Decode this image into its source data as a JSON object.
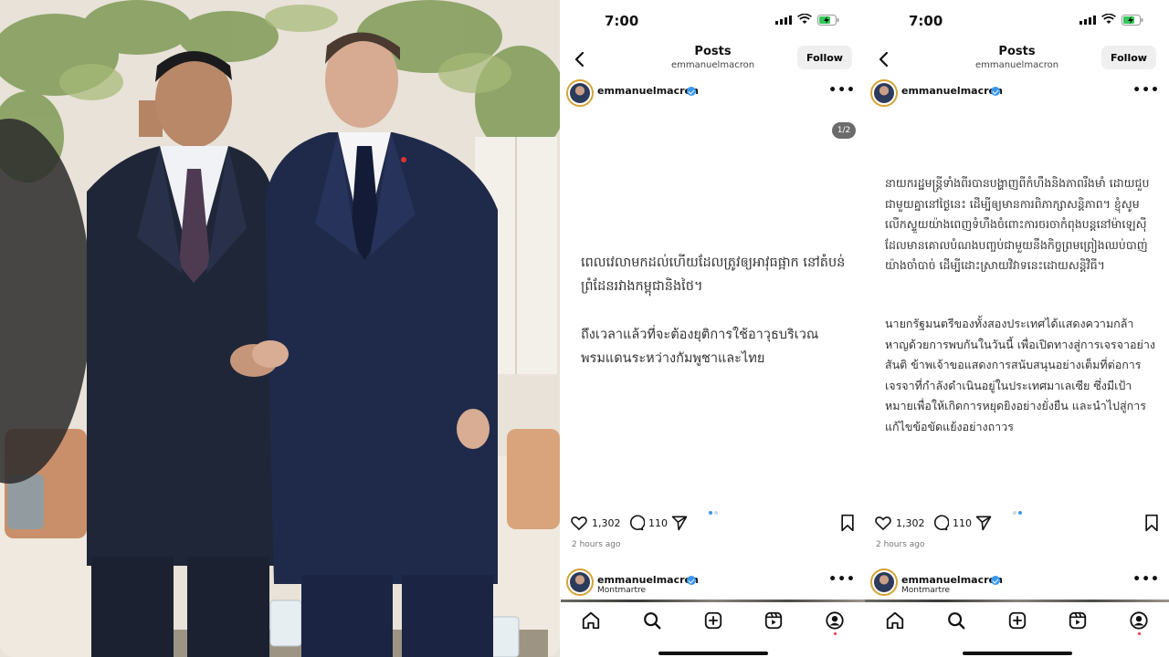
{
  "status": {
    "time": "7:00"
  },
  "nav": {
    "title": "Posts",
    "subtitle": "emmanuelmacron",
    "follow_label": "Follow"
  },
  "post": {
    "username": "emmanuelmacron",
    "counter": "1/2",
    "slide1_p1": "ពេលវេលាមកដល់ហើយដែលត្រូវឲ្យអាវុធផ្អាក នៅតំបន់ព្រំដែនរវាងកម្ពុជានិងថៃ។",
    "slide1_p2": "ถึงเวลาแล้วที่จะต้องยุติการใช้อาวุธบริเวณ พรมแดนระหว่างกัมพูชาและไทย",
    "slide2_p1": "នាយករដ្ឋមន្ត្រីទាំងពីរបានបង្ហាញពីកំហឹងនិងភាពរឹងមាំ ដោយជួបជាមួយគ្នានៅថ្ងៃនេះ ដើម្បីឲ្យមានការពិភាក្សាសន្តិភាព។ ខ្ញុំសូមលើកស្ទួយយ៉ាងពេញទំហឹងចំពោះការចរចាកំពុងបន្តនៅម៉ាឡេស៊ី ដែលមានគោលបំណងបញ្ចប់ជាមួយនឹងកិច្ចព្រមព្រៀងឈប់បាញ់យ៉ាងចាំបាច់ ដើម្បីដោះស្រាយវិវាទនេះដោយសន្តិវិធី។",
    "slide2_p2": "นายกรัฐมนตรีของทั้งสองประเทศได้แสดงความกล้าหาญด้วยการพบกันในวันนี้ เพื่อเปิดทางสู่การเจรจาอย่างสันติ ข้าพเจ้าขอแสดงการสนับสนุนอย่างเต็มที่ต่อการเจรจาที่กำลังดำเนินอยู่ในประเทศมาเลเซีย ซึ่งมีเป้าหมายเพื่อให้เกิดการหยุดยิงอย่างยั่งยืน และนำไปสู่การแก้ไขข้อขัดแย้งอย่างถาวร",
    "likes": "1,302",
    "comments": "110",
    "time_ago": "2 hours ago"
  },
  "next_post": {
    "username": "emmanuelmacron",
    "location": "Montmartre"
  },
  "icons": {
    "back": "chevron-left-icon",
    "heart": "heart-icon",
    "comment": "comment-icon",
    "share": "send-icon",
    "bookmark": "bookmark-icon",
    "home": "home-icon",
    "search": "search-icon",
    "create": "plus-square-icon",
    "reels": "reels-icon",
    "profile": "profile-icon"
  },
  "colors": {
    "verified": "#3897f0",
    "follow_bg": "#efefef",
    "active_dot": "#3897f0",
    "notif": "#e8334a"
  }
}
